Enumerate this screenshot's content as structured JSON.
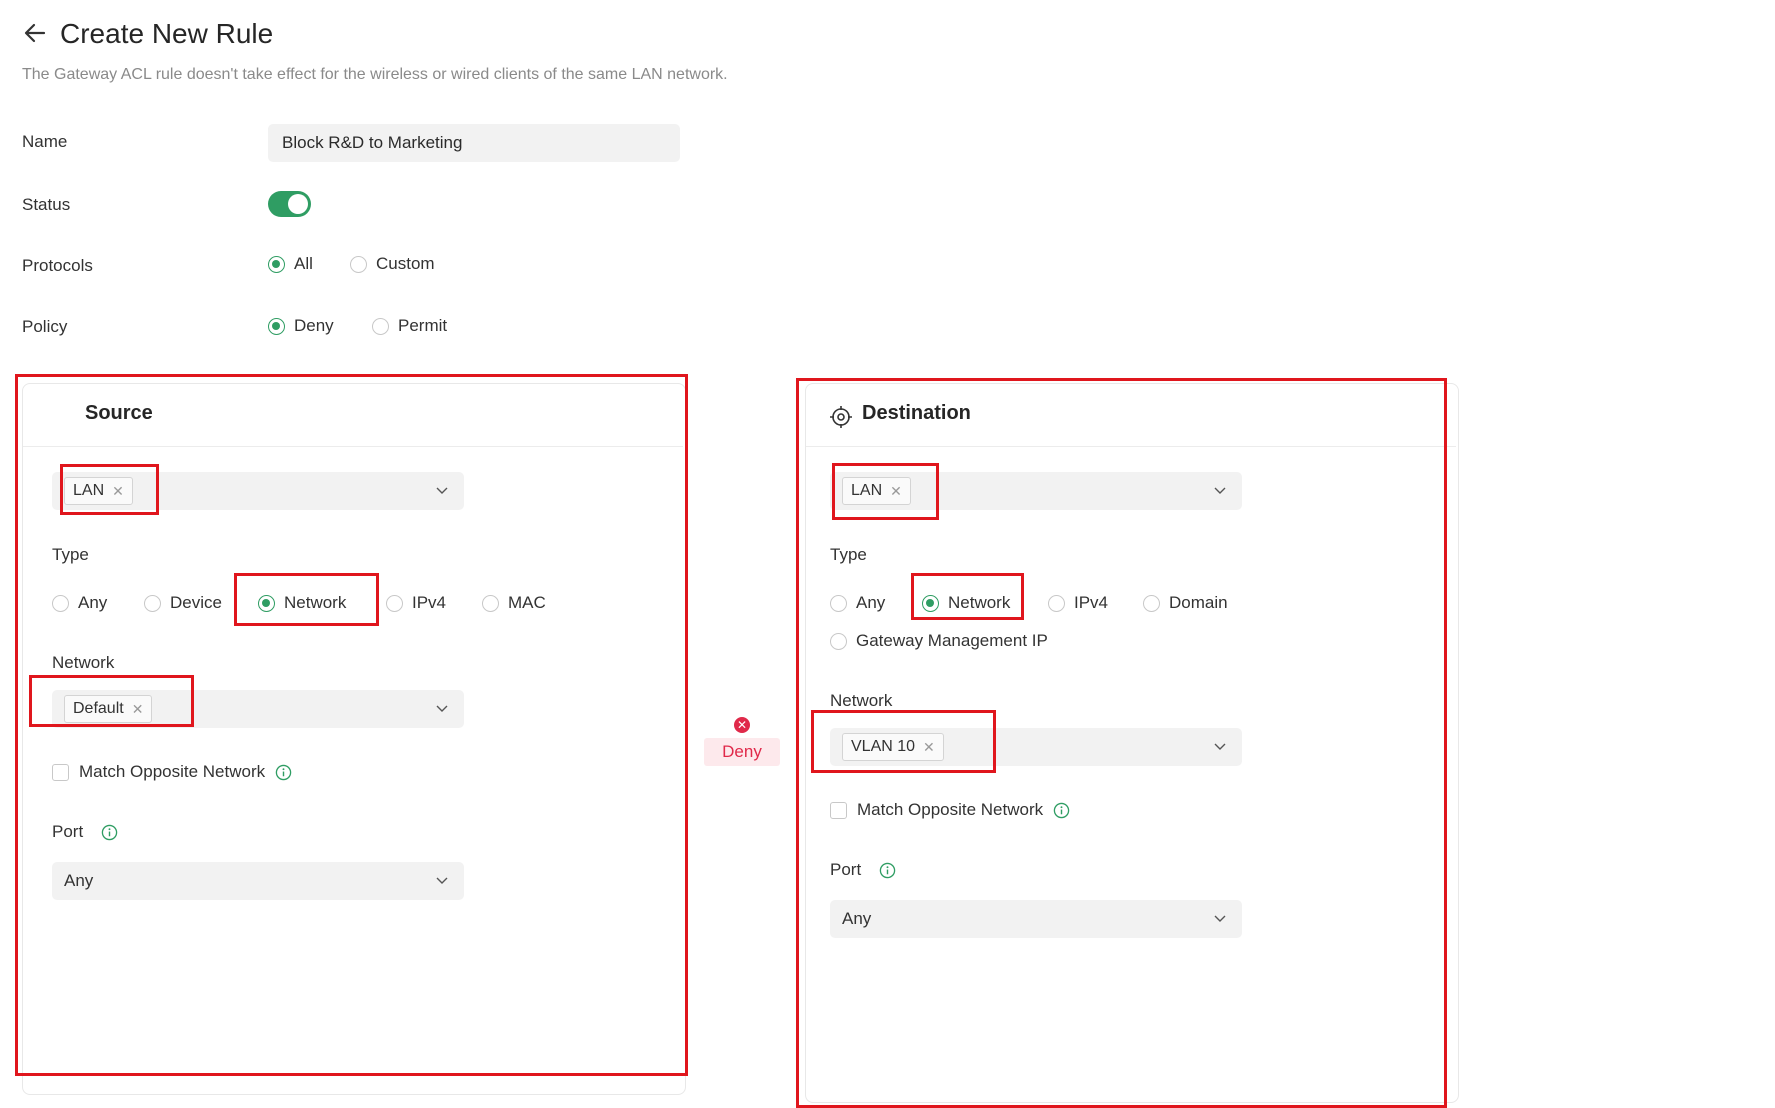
{
  "header": {
    "title": "Create New Rule",
    "subtitle": "The Gateway ACL rule doesn't take effect for the wireless or wired clients of the same LAN network."
  },
  "form": {
    "name_label": "Name",
    "name_value": "Block R&D to Marketing",
    "status_label": "Status",
    "status_enabled": true,
    "protocols_label": "Protocols",
    "protocols_options": [
      "All",
      "Custom"
    ],
    "protocols_selected": "All",
    "policy_label": "Policy",
    "policy_options": [
      "Deny",
      "Permit"
    ],
    "policy_selected": "Deny"
  },
  "source": {
    "title": "Source",
    "zone_tag": "LAN",
    "type_label": "Type",
    "type_options": [
      "Any",
      "Device",
      "Network",
      "IPv4",
      "MAC"
    ],
    "type_selected": "Network",
    "network_label": "Network",
    "network_tag": "Default",
    "match_opposite_label": "Match Opposite Network",
    "port_label": "Port",
    "port_value": "Any"
  },
  "connector": {
    "policy_badge": "Deny"
  },
  "destination": {
    "title": "Destination",
    "zone_tag": "LAN",
    "type_label": "Type",
    "type_options": [
      "Any",
      "Network",
      "IPv4",
      "Domain",
      "Gateway Management IP"
    ],
    "type_selected": "Network",
    "network_label": "Network",
    "network_tag": "VLAN 10",
    "match_opposite_label": "Match Opposite Network",
    "port_label": "Port",
    "port_value": "Any"
  },
  "colors": {
    "accent": "#2f9d63",
    "highlight_box": "#e0161d",
    "deny": "#e0294a"
  }
}
